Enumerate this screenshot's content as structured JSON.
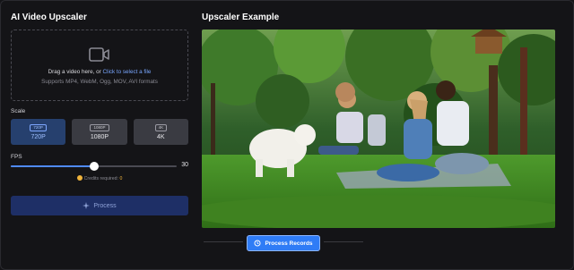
{
  "upscaler": {
    "title": "AI Video Upscaler",
    "dropzone": {
      "prompt_prefix": "Drag a video here, or ",
      "prompt_link": "Click to select a file",
      "formats": "Supports MP4, WebM, Ogg, MOV, AVI formats",
      "icon": "video-camera-icon"
    },
    "scale": {
      "label": "Scale",
      "options": [
        {
          "tag": "720P",
          "label": "720P",
          "selected": true
        },
        {
          "tag": "1080P",
          "label": "1080P",
          "selected": false
        },
        {
          "tag": "4K",
          "label": "4K",
          "selected": false
        }
      ]
    },
    "fps": {
      "label": "FPS",
      "value": 30,
      "min": 0,
      "max": 60
    },
    "credits": {
      "text": "Credits required:",
      "amount": "0"
    },
    "process_button": "Process"
  },
  "example": {
    "title": "Upscaler Example",
    "records_button": "Process Records"
  },
  "colors": {
    "background": "#141417",
    "accent": "#2f7cf6",
    "selected_option": "#26406e",
    "process_button": "#1e2f66",
    "credits": "#f0b43c"
  }
}
